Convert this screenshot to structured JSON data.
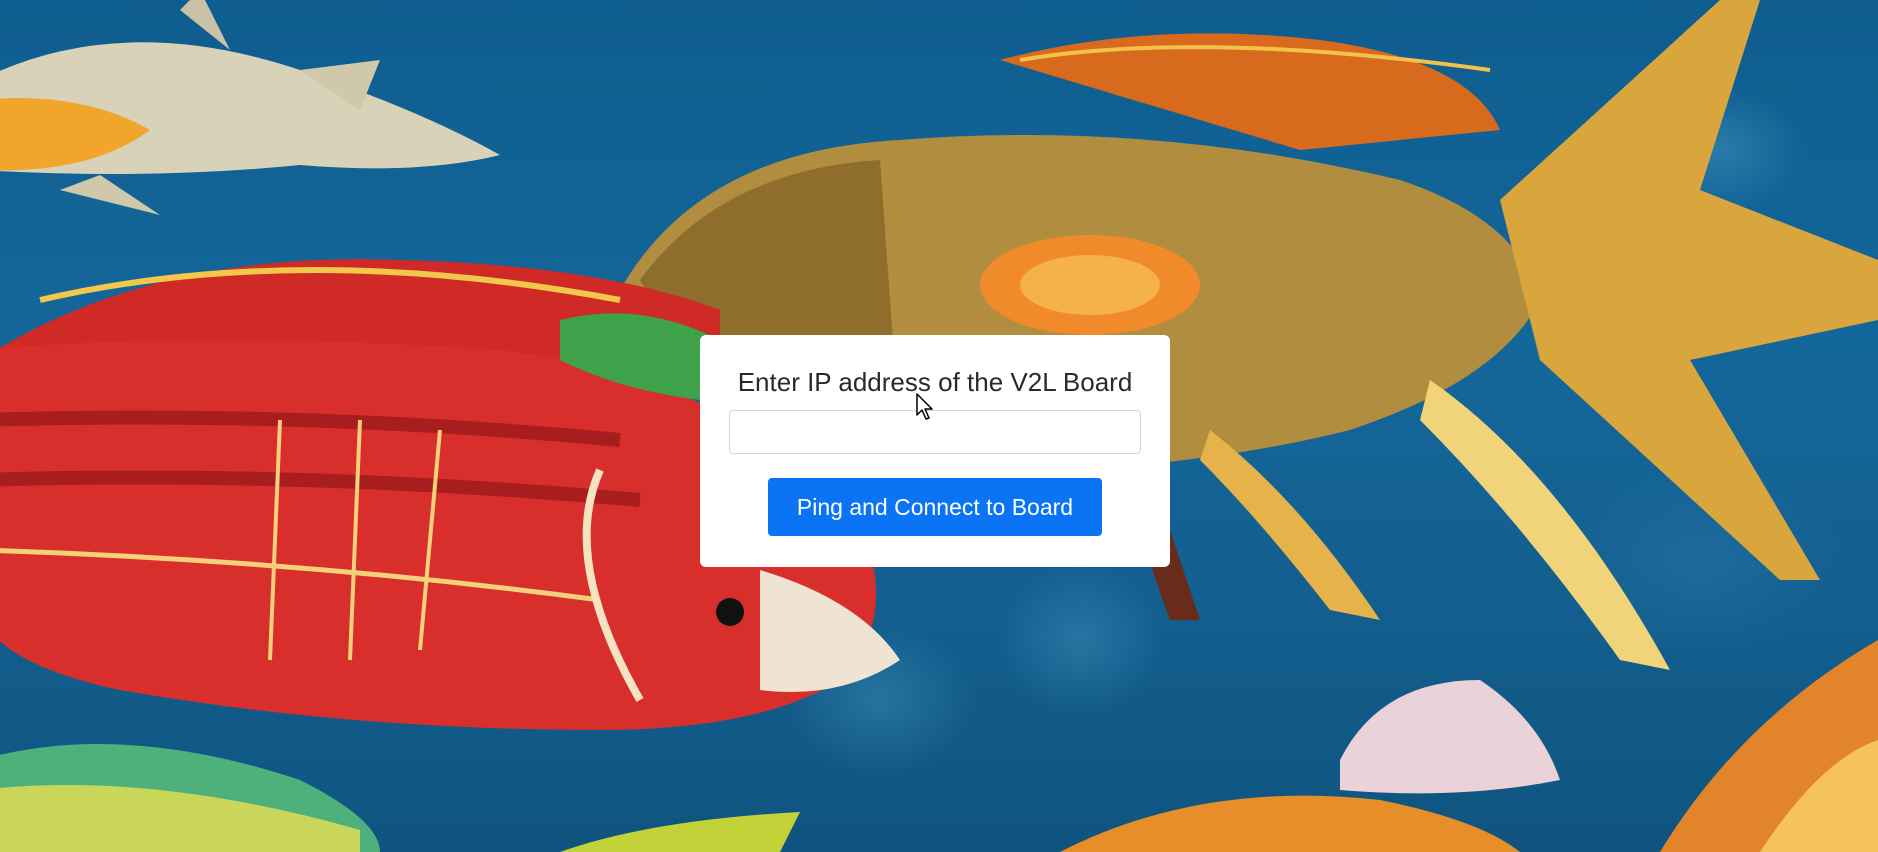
{
  "dialog": {
    "title": "Enter IP address of the V2L Board",
    "ip_input_value": "",
    "ip_input_placeholder": "",
    "connect_button_label": "Ping and Connect to Board"
  },
  "background": {
    "description_icon": "fish-illustration",
    "ocean_color": "#14679b"
  },
  "colors": {
    "button": "#0a74f5",
    "dialog_bg": "#ffffff"
  }
}
